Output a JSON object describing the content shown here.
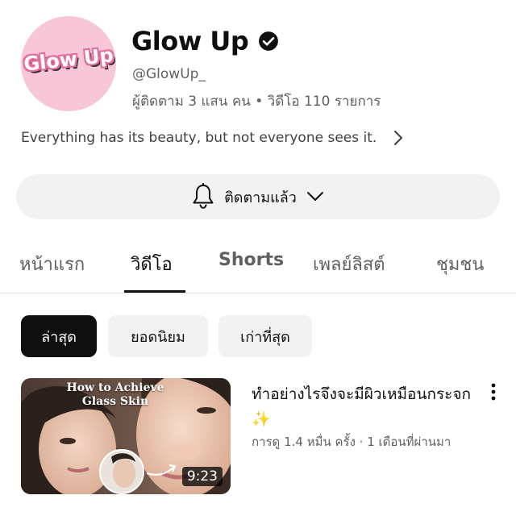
{
  "channel": {
    "avatar_text": "Glow Up",
    "name": "Glow Up",
    "handle": "@GlowUp_",
    "stats": "ผู้ติดตาม 3 แสน คน • วิดีโอ 110 รายการ",
    "description": "Everything has its beauty, but not everyone sees it."
  },
  "subscribe": {
    "label": "ติดตามแล้ว",
    "icon": "bell-icon"
  },
  "tabs": [
    {
      "label": "หน้าแรก",
      "active": false
    },
    {
      "label": "วิดีโอ",
      "active": true
    },
    {
      "label": "Shorts",
      "active": false
    },
    {
      "label": "เพลย์ลิสต์",
      "active": false
    },
    {
      "label": "ชุมชน",
      "active": false
    }
  ],
  "filters": [
    {
      "label": "ล่าสุด",
      "selected": true
    },
    {
      "label": "ยอดนิยม",
      "selected": false
    },
    {
      "label": "เก่าที่สุด",
      "selected": false
    }
  ],
  "videos": [
    {
      "thumbnail_text": "How to Achieve Glass Skin",
      "duration": "9:23",
      "title": "ทำอย่างไรจึงจะมีผิวเหมือนกระจก ✨",
      "meta": "การดู 1.4 หมื่น ครั้ง · 1 เดือนที่ผ่านมา"
    }
  ],
  "colors": {
    "text_primary": "#0f0f0f",
    "text_secondary": "#606060",
    "chip_bg": "#f2f2f2",
    "avatar_bg": "#f7c7d8"
  }
}
